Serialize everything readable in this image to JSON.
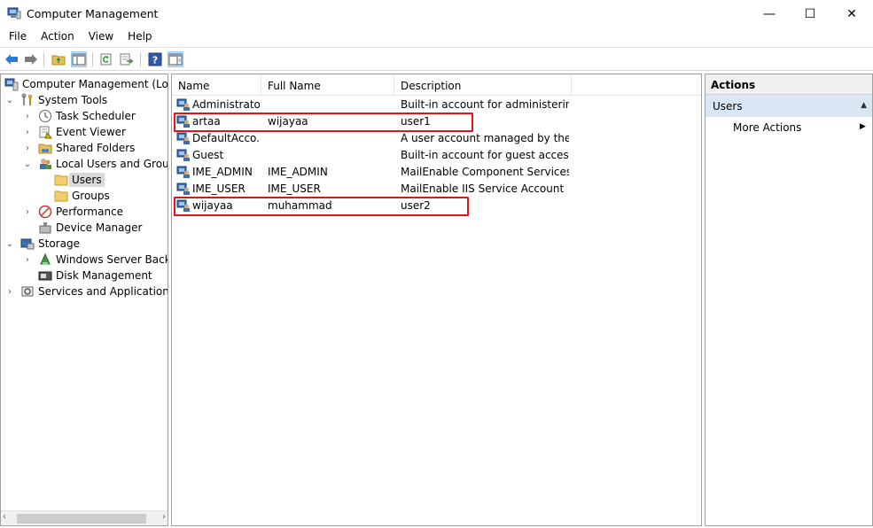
{
  "window": {
    "title": "Computer Management",
    "minimize_glyph": "—",
    "maximize_glyph": "☐",
    "close_glyph": "✕"
  },
  "menu": [
    "File",
    "Action",
    "View",
    "Help"
  ],
  "toolbar": {
    "icons": [
      "back-arrow-icon",
      "forward-arrow-icon",
      "up-folder-icon",
      "show-hide-tree-icon",
      "refresh-icon",
      "export-list-icon",
      "help-icon",
      "action-pane-icon"
    ],
    "help_glyph": "?"
  },
  "tree": {
    "items": [
      {
        "label": "Computer Management (Local",
        "level": 0,
        "chevron": "",
        "icon": "computer-management-icon"
      },
      {
        "label": "System Tools",
        "level": 1,
        "chevron": "⌄",
        "icon": "system-tools-icon"
      },
      {
        "label": "Task Scheduler",
        "level": 2,
        "chevron": "›",
        "icon": "clock-icon"
      },
      {
        "label": "Event Viewer",
        "level": 2,
        "chevron": "›",
        "icon": "event-viewer-icon"
      },
      {
        "label": "Shared Folders",
        "level": 2,
        "chevron": "›",
        "icon": "shared-folder-icon"
      },
      {
        "label": "Local Users and Groups",
        "level": 2,
        "chevron": "⌄",
        "icon": "users-group-icon"
      },
      {
        "label": "Users",
        "level": 3,
        "chevron": "",
        "icon": "folder-icon",
        "selected": true
      },
      {
        "label": "Groups",
        "level": 3,
        "chevron": "",
        "icon": "folder-icon"
      },
      {
        "label": "Performance",
        "level": 2,
        "chevron": "›",
        "icon": "performance-icon"
      },
      {
        "label": "Device Manager",
        "level": 2,
        "chevron": "",
        "icon": "device-manager-icon"
      },
      {
        "label": "Storage",
        "level": 1,
        "chevron": "⌄",
        "icon": "storage-icon"
      },
      {
        "label": "Windows Server Backup",
        "level": 2,
        "chevron": "›",
        "icon": "backup-icon"
      },
      {
        "label": "Disk Management",
        "level": 2,
        "chevron": "",
        "icon": "disk-icon"
      },
      {
        "label": "Services and Applications",
        "level": 1,
        "chevron": "›",
        "icon": "services-icon"
      }
    ],
    "scroll_left": "‹",
    "scroll_right": "›"
  },
  "list": {
    "columns": [
      "Name",
      "Full Name",
      "Description"
    ],
    "rows": [
      {
        "name": "Administrator",
        "full_name": "",
        "description": "Built-in account for administering..."
      },
      {
        "name": "artaa",
        "full_name": "wijayaa",
        "description": "user1",
        "highlight": true
      },
      {
        "name": "DefaultAcco...",
        "full_name": "",
        "description": "A user account managed by the s..."
      },
      {
        "name": "Guest",
        "full_name": "",
        "description": "Built-in account for guest access t..."
      },
      {
        "name": "IME_ADMIN",
        "full_name": "IME_ADMIN",
        "description": "MailEnable Component Services ..."
      },
      {
        "name": "IME_USER",
        "full_name": "IME_USER",
        "description": "MailEnable IIS Service Account"
      },
      {
        "name": "wijayaa",
        "full_name": "muhammad",
        "description": "user2",
        "highlight": true
      }
    ]
  },
  "actions": {
    "header": "Actions",
    "section": "Users",
    "collapse_glyph": "▲",
    "item": "More Actions",
    "item_arrow": "▶"
  },
  "colors": {
    "highlight_box": "#e0141a",
    "selection": "#d9d9d9",
    "action_section": "#d9e7f5"
  }
}
